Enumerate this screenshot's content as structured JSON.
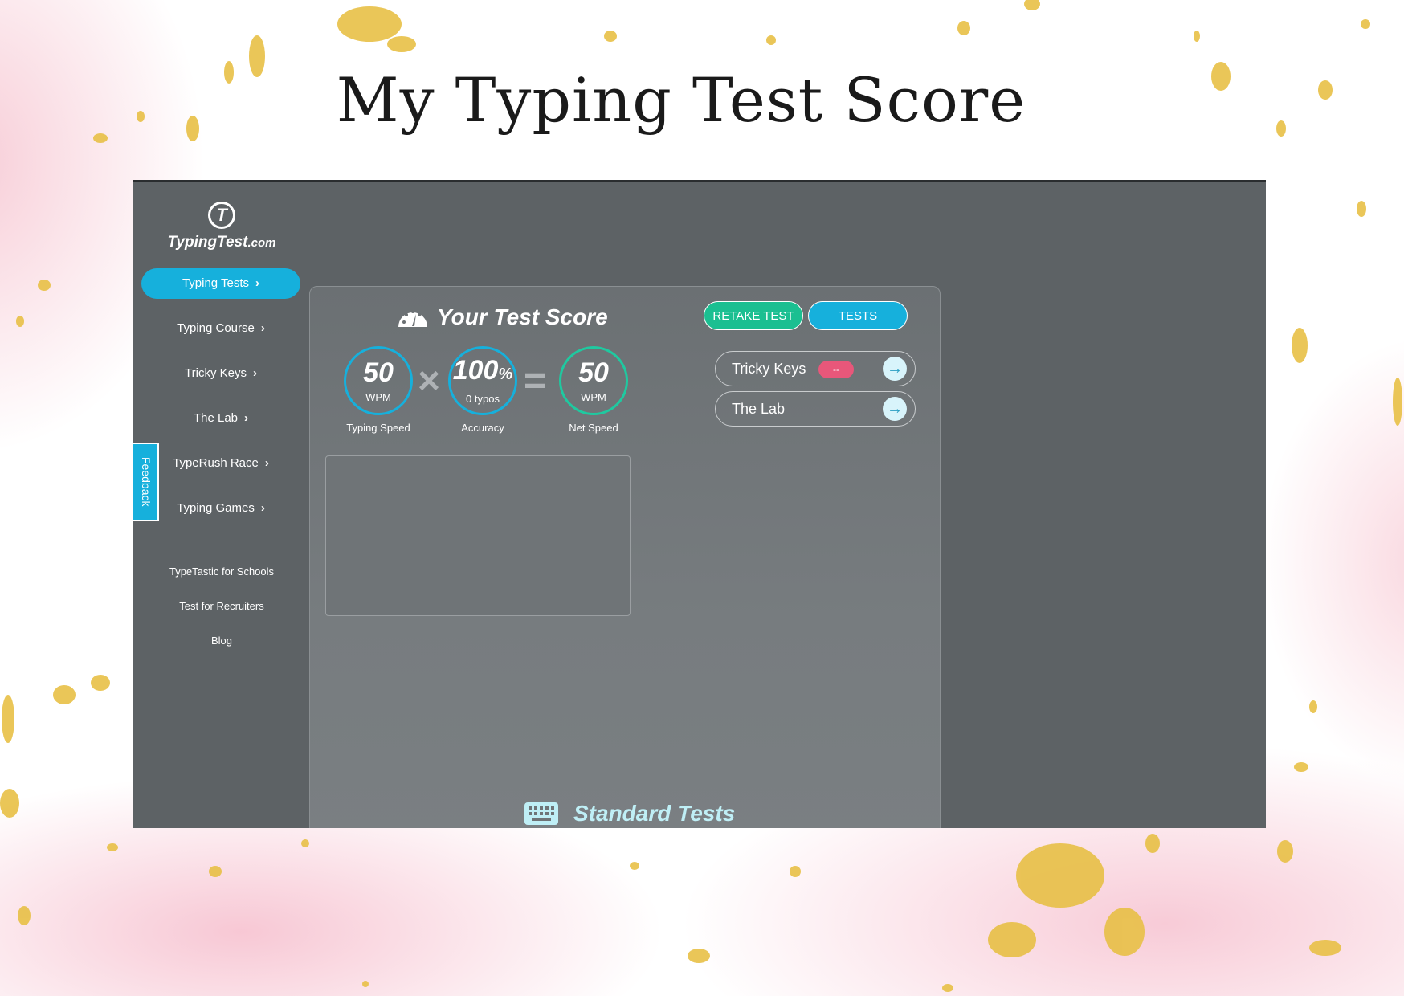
{
  "page": {
    "heading": "My Typing Test Score"
  },
  "app": {
    "logo": {
      "mark": "T",
      "name": "TypingTest",
      "tld": ".com"
    },
    "nav": [
      {
        "label": "Typing Tests",
        "active": true
      },
      {
        "label": "Typing Course",
        "active": false
      },
      {
        "label": "Tricky Keys",
        "active": false
      },
      {
        "label": "The Lab",
        "active": false
      },
      {
        "label": "TypeRush Race",
        "active": false
      },
      {
        "label": "Typing Games",
        "active": false
      }
    ],
    "subnav": [
      "TypeTastic for Schools",
      "Test for Recruiters",
      "Blog"
    ],
    "feedback_label": "Feedback",
    "score": {
      "title": "Your Test Score",
      "typing_speed": {
        "value": "50",
        "unit": "WPM",
        "label": "Typing Speed"
      },
      "accuracy": {
        "value": "100",
        "unit_symbol": "%",
        "typos": "0  typos",
        "label": "Accuracy"
      },
      "net_speed": {
        "value": "50",
        "unit": "WPM",
        "label": "Net Speed"
      },
      "times_symbol": "×",
      "equals_symbol": "="
    },
    "buttons": {
      "retake": "RETAKE TEST",
      "tests": "TESTS"
    },
    "links": [
      {
        "label": "Tricky Keys",
        "badge": "--"
      },
      {
        "label": "The Lab"
      }
    ],
    "section_title": "Standard Tests",
    "colors": {
      "accent_blue": "#16b0dc",
      "accent_green": "#1bbf91",
      "badge_pink": "#e8577a",
      "panel_gray": "#5d6265"
    },
    "icons": [
      "speedometer-icon",
      "keyboard-icon",
      "arrow-right-icon",
      "chevron-right-icon"
    ]
  }
}
